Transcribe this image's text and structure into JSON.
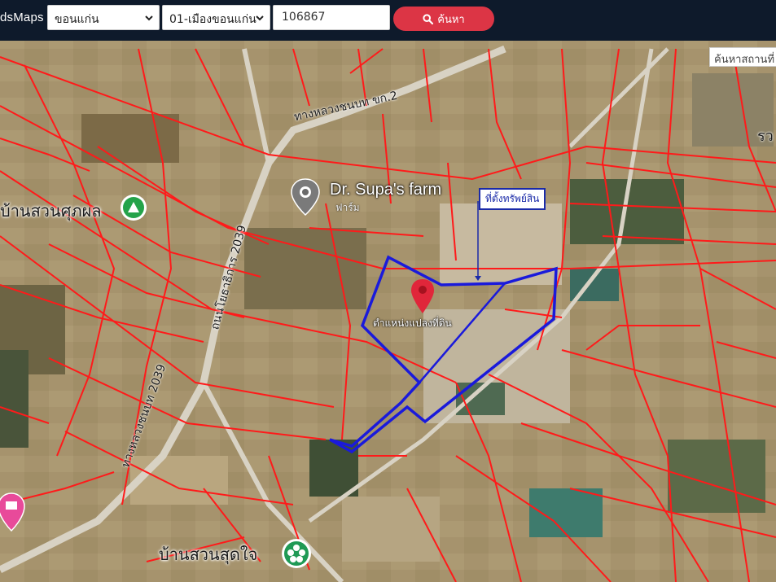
{
  "header": {
    "brand": "dsMaps",
    "province": "ขอนแก่น",
    "district": "01-เมืองขอนแก่น",
    "parcel_number": "106867",
    "search_button": "ค้นหา"
  },
  "map": {
    "place_search_placeholder": "ค้นหาสถานที่",
    "farm_name": "Dr. Supa's farm",
    "farm_sub": "ฟาร์ม",
    "poi_village_1": "บ้านสวนศุภผล",
    "poi_village_2": "บ้านสวนสุดใจ",
    "asset_tag": "ที่ตั้งทรัพย์สิน",
    "plot_label": "ตำแหน่งแปลงที่ดิน",
    "road_1": "ทางหลวงชนบท ขก.2",
    "road_2": "ถนนโยธาธิการ 2039",
    "road_3": "ทางหลวงชนบท 2039",
    "corner_label": "รว",
    "colors": {
      "parcel_lines": "#ff1a1a",
      "plot_outline": "#1a1adb",
      "marker": "#e0263a",
      "header_bg": "#0e1a2b",
      "button": "#dc3545"
    }
  }
}
